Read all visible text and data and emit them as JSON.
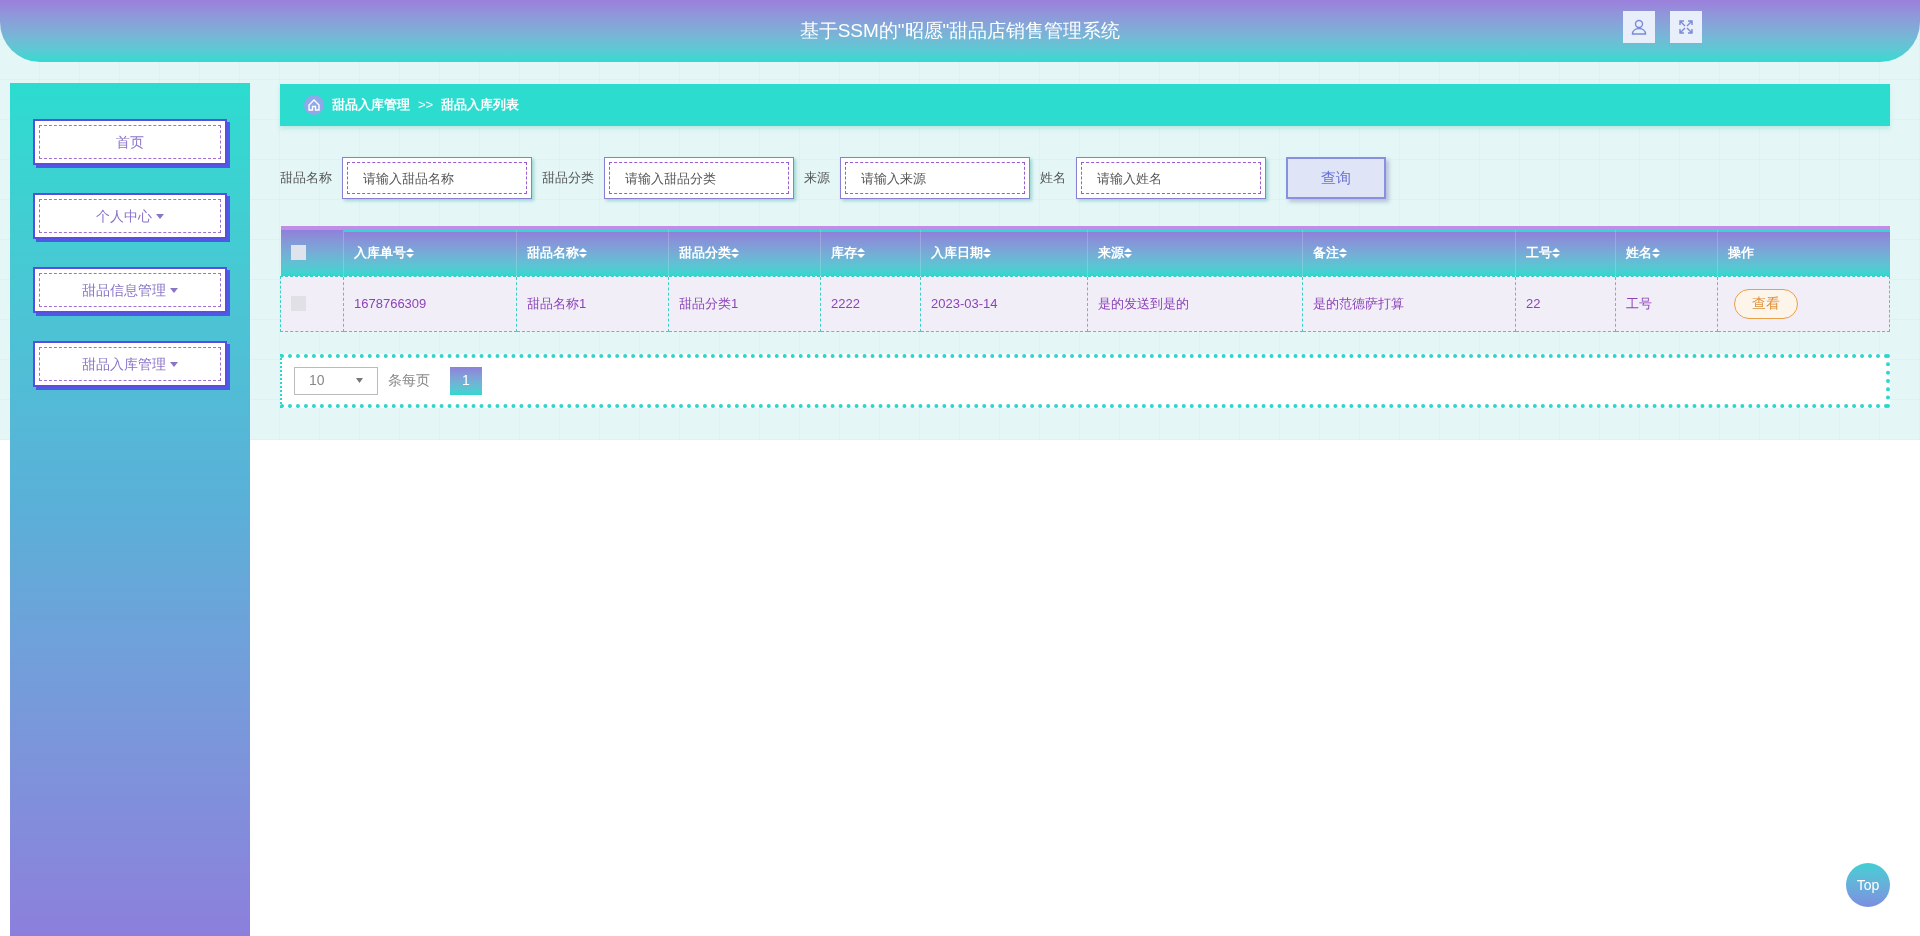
{
  "header": {
    "title": "基于SSM的\"昭愿\"甜品店销售管理系统"
  },
  "sidebar": {
    "items": [
      {
        "label": "首页",
        "kind": "link"
      },
      {
        "label": "个人中心",
        "kind": "menu"
      },
      {
        "label": "甜品信息管理",
        "kind": "menu"
      },
      {
        "label": "甜品入库管理",
        "kind": "menu"
      }
    ]
  },
  "breadcrumb": {
    "items": [
      "甜品入库管理",
      "甜品入库列表"
    ],
    "separator": ">>"
  },
  "search": {
    "fields": [
      {
        "label": "甜品名称",
        "placeholder": "请输入甜品名称"
      },
      {
        "label": "甜品分类",
        "placeholder": "请输入甜品分类"
      },
      {
        "label": "来源",
        "placeholder": "请输入来源"
      },
      {
        "label": "姓名",
        "placeholder": "请输入姓名"
      }
    ],
    "button": "查询"
  },
  "table": {
    "select_all": {
      "checked": false
    },
    "columns": [
      {
        "label": "入库单号",
        "sortable": true
      },
      {
        "label": "甜品名称",
        "sortable": true
      },
      {
        "label": "甜品分类",
        "sortable": true
      },
      {
        "label": "库存",
        "sortable": true
      },
      {
        "label": "入库日期",
        "sortable": true
      },
      {
        "label": "来源",
        "sortable": true
      },
      {
        "label": "备注",
        "sortable": true
      },
      {
        "label": "工号",
        "sortable": true
      },
      {
        "label": "姓名",
        "sortable": true
      },
      {
        "label": "操作",
        "sortable": false
      }
    ],
    "rows": [
      {
        "checked": false,
        "cells": [
          "1678766309",
          "甜品名称1",
          "甜品分类1",
          "2222",
          "2023-03-14",
          "是的发送到是的",
          "是的范德萨打算",
          "22",
          "工号"
        ],
        "action": "查看"
      }
    ]
  },
  "pagination": {
    "page_size": "10",
    "page_size_label": "条每页",
    "pages": [
      {
        "label": "1",
        "selected": true
      }
    ]
  },
  "top_button": "Top"
}
